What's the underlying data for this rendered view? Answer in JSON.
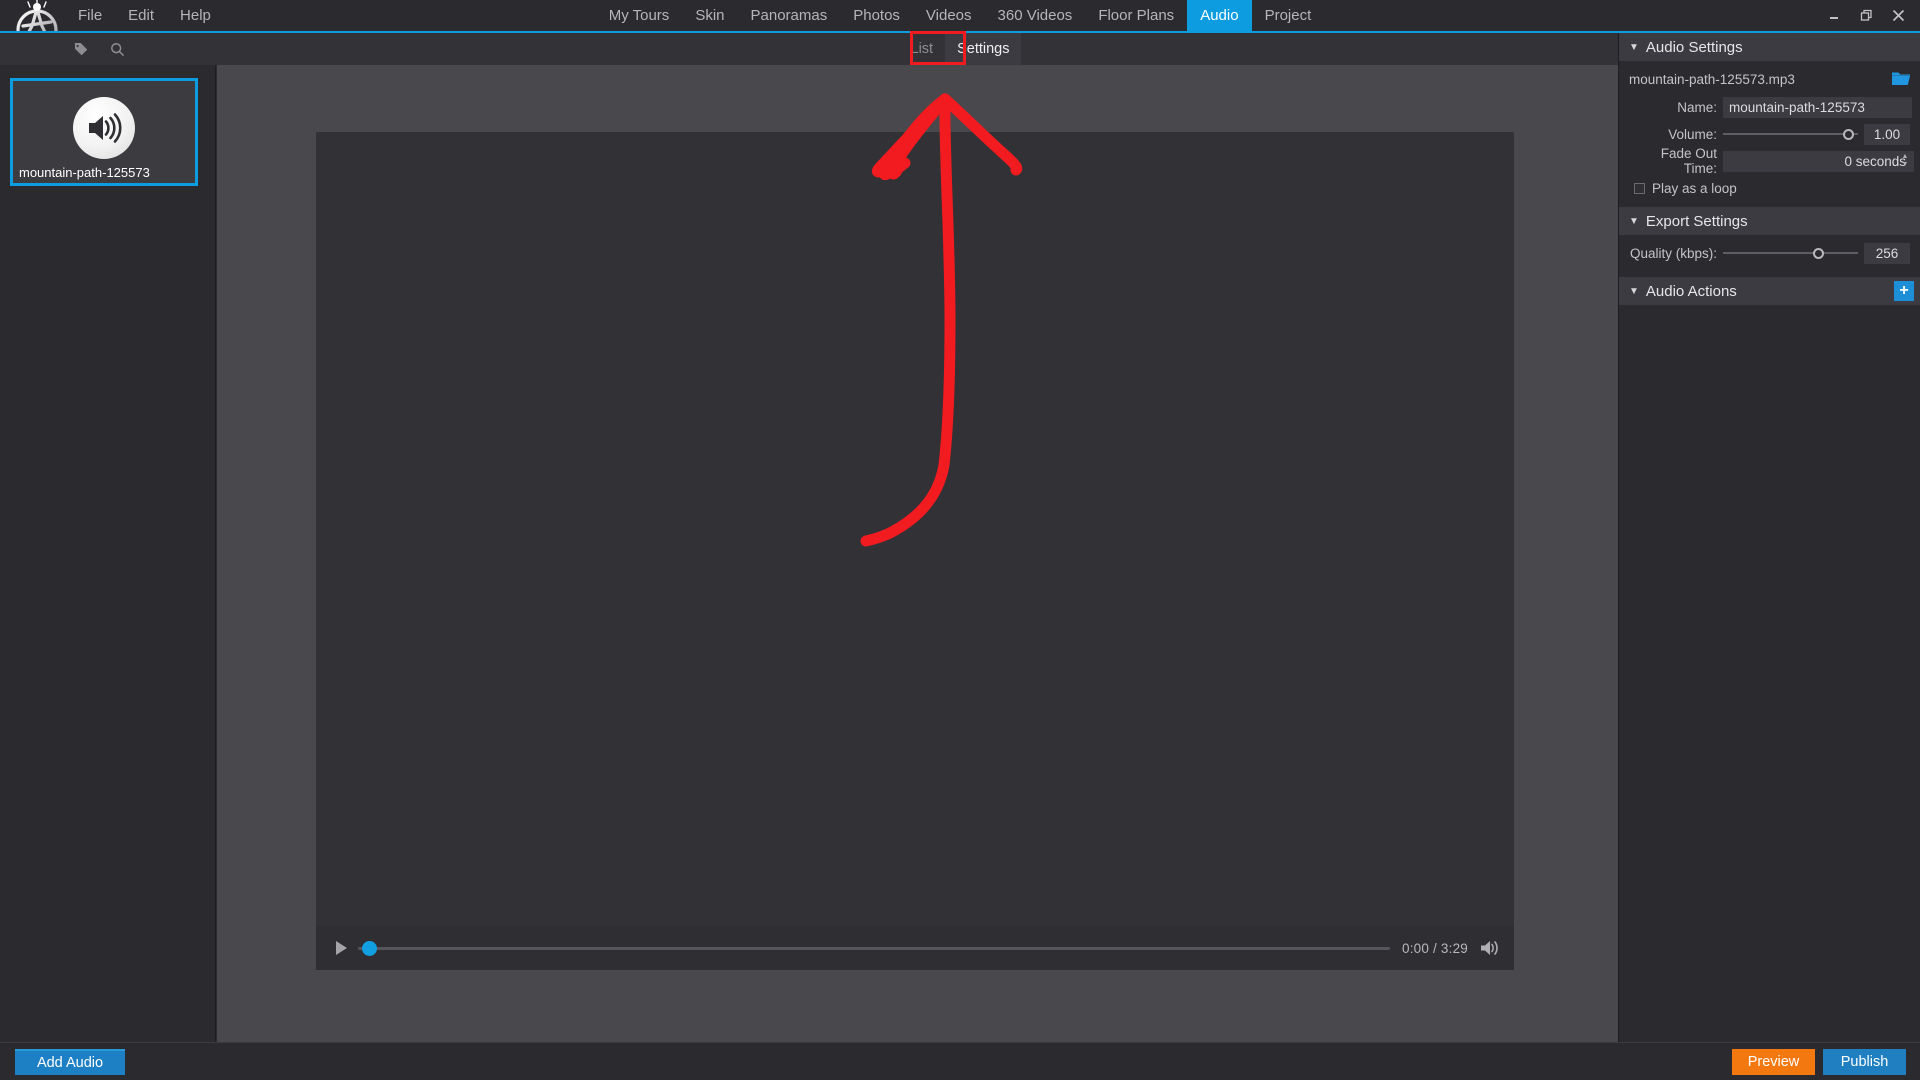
{
  "app": {
    "menu": [
      {
        "label": "File",
        "name": "menu-file"
      },
      {
        "label": "Edit",
        "name": "menu-edit"
      },
      {
        "label": "Help",
        "name": "menu-help"
      }
    ],
    "nav_tabs": [
      {
        "label": "My Tours",
        "active": false
      },
      {
        "label": "Skin",
        "active": false
      },
      {
        "label": "Panoramas",
        "active": false
      },
      {
        "label": "Photos",
        "active": false
      },
      {
        "label": "Videos",
        "active": false
      },
      {
        "label": "360 Videos",
        "active": false
      },
      {
        "label": "Floor Plans",
        "active": false
      },
      {
        "label": "Audio",
        "active": true
      },
      {
        "label": "Project",
        "active": false
      }
    ],
    "window_controls": [
      "minimize",
      "restore",
      "close"
    ],
    "accent_color": "#0e9ce0"
  },
  "subbar": {
    "icons": [
      {
        "name": "tag-icon"
      },
      {
        "name": "search-icon"
      }
    ],
    "tabs": [
      {
        "label": "List",
        "active": false
      },
      {
        "label": "Settings",
        "active": true
      }
    ],
    "highlight": {
      "target": "Settings",
      "color": "#f21b20"
    }
  },
  "sidebar": {
    "items": [
      {
        "label": "mountain-path-125573",
        "icon": "speaker-icon",
        "selected": true
      }
    ]
  },
  "player": {
    "play_label": "play",
    "time": "0:00 / 3:29",
    "progress_percent": 0,
    "volume_icon": "speaker-icon"
  },
  "annotation": {
    "type": "hand-drawn-arrow",
    "color": "#f21b20",
    "points_to": "Settings tab"
  },
  "right_panel": {
    "sections": [
      {
        "title": "Audio Settings",
        "file_name": "mountain-path-125573.mp3",
        "browse_icon": "folder-open-icon",
        "fields": {
          "name_label": "Name:",
          "name_value": "mountain-path-125573",
          "volume_label": "Volume:",
          "volume_value": "1.00",
          "volume_percent": 94,
          "fade_label": "Fade Out Time:",
          "fade_value": "0 seconds",
          "loop_label": "Play as a loop",
          "loop_checked": false
        }
      },
      {
        "title": "Export Settings",
        "fields": {
          "quality_label": "Quality (kbps):",
          "quality_value": "256",
          "quality_percent": 72
        }
      },
      {
        "title": "Audio Actions",
        "add_label": "+"
      }
    ]
  },
  "bottom_bar": {
    "add_audio": "Add Audio",
    "preview": "Preview",
    "publish": "Publish",
    "colors": {
      "add": "#1d7fc4",
      "preview": "#f2780f",
      "publish": "#1f7fc0"
    }
  }
}
